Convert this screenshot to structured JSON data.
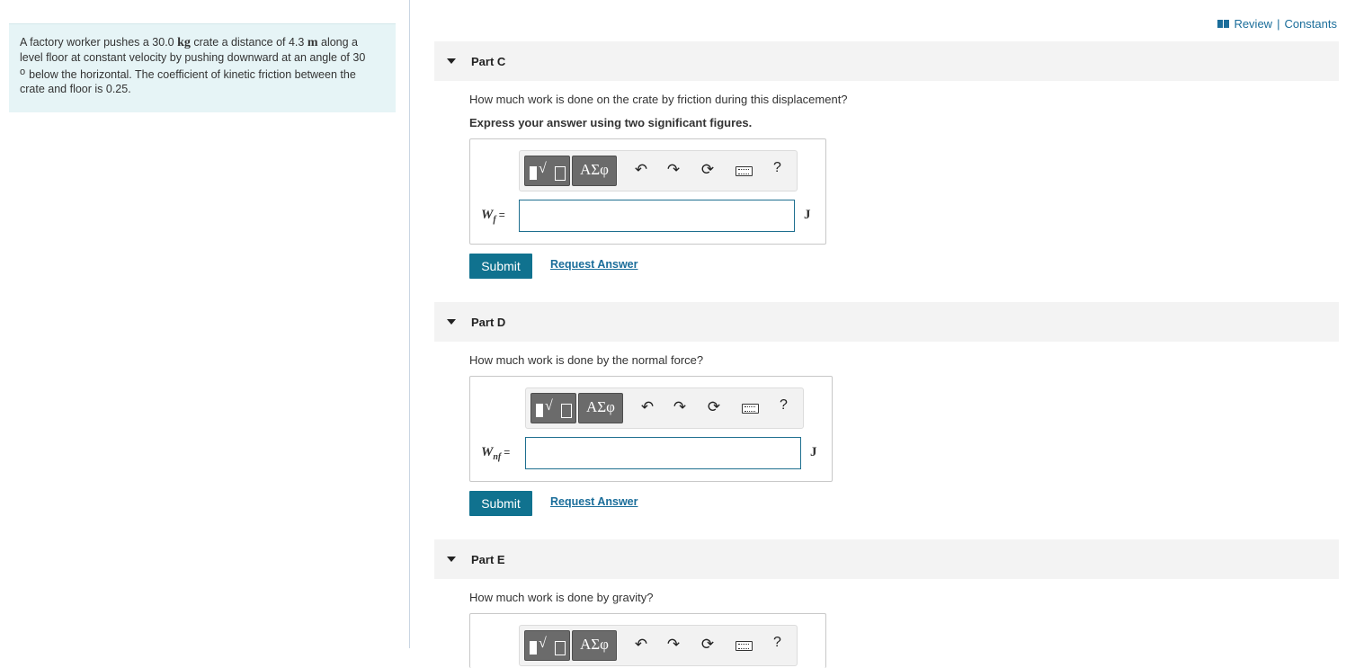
{
  "problem": {
    "text_1": "A factory worker pushes a 30.0 ",
    "mass_unit": "kg",
    "text_2": " crate a distance of 4.3 ",
    "dist_unit": "m",
    "text_3": " along a level floor at constant velocity by pushing downward at an angle of 30",
    "degree": "o",
    "text_4": "below the horizontal. The coefficient of kinetic friction between the crate and floor is 0.25."
  },
  "header": {
    "review": "Review",
    "separator": "|",
    "constants": "Constants"
  },
  "toolbar": {
    "greek": "ΑΣφ",
    "undo_icon": "undo-icon",
    "redo_icon": "redo-icon",
    "reset_icon": "reset-icon",
    "keyboard_icon": "keyboard-icon",
    "help": "?"
  },
  "parts": [
    {
      "label": "Part C",
      "question": "How much work is done on the crate by friction during this displacement?",
      "instruction": "Express your answer using two significant figures.",
      "var_main": "W",
      "var_sub": "f",
      "eq": "=",
      "value": "",
      "unit": "J",
      "submit": "Submit",
      "request": "Request Answer"
    },
    {
      "label": "Part D",
      "question": "How much work is done by the normal force?",
      "var_main": "W",
      "var_sub": "nf",
      "eq": "=",
      "value": "",
      "unit": "J",
      "submit": "Submit",
      "request": "Request Answer"
    },
    {
      "label": "Part E",
      "question": "How much work is done by gravity?"
    }
  ]
}
